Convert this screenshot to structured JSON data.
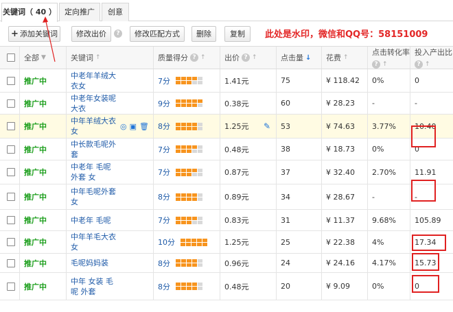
{
  "tabs": [
    {
      "label": "关键词",
      "count": "（ 40 ）",
      "active": true
    },
    {
      "label": "定向推广",
      "active": false
    },
    {
      "label": "创意",
      "active": false
    }
  ],
  "toolbar": {
    "add_keyword": "添加关键词",
    "edit_bid": "修改出价",
    "edit_match": "修改匹配方式",
    "delete": "删除",
    "copy": "复制",
    "help_glyph": "?"
  },
  "watermark": "此处是水印，微信和QQ号：58151009",
  "table": {
    "headers": {
      "all": "全部",
      "keyword": "关键词",
      "quality": "质量得分",
      "bid": "出价",
      "clicks": "点击量",
      "cost": "花费",
      "cvr": "点击转化率",
      "roi": "投入产出比"
    },
    "rows": [
      {
        "status": "推广中",
        "keyword": [
          "中老年羊绒大",
          "衣女"
        ],
        "score": "7分",
        "bars": 7,
        "bid": "1.41元",
        "clicks": "75",
        "cost": "¥ 118.42",
        "cvr": "0%",
        "roi": "0"
      },
      {
        "status": "推广中",
        "keyword": [
          "中老年女装呢",
          "大衣"
        ],
        "score": "9分",
        "bars": 9,
        "bid": "0.38元",
        "clicks": "60",
        "cost": "¥ 28.23",
        "cvr": "-",
        "roi": "-"
      },
      {
        "status": "推广中",
        "keyword": [
          "中年羊绒大衣",
          "女"
        ],
        "score": "8分",
        "bars": 8,
        "bid": "1.25元",
        "clicks": "53",
        "cost": "¥ 74.63",
        "cvr": "3.77%",
        "roi": "10.40"
      },
      {
        "status": "推广中",
        "keyword": [
          "中长款毛呢外",
          "套"
        ],
        "score": "7分",
        "bars": 7,
        "bid": "0.48元",
        "clicks": "38",
        "cost": "¥ 18.73",
        "cvr": "0%",
        "roi": "0"
      },
      {
        "status": "推广中",
        "keyword": [
          "中老年 毛呢",
          "外套 女"
        ],
        "score": "7分",
        "bars": 7,
        "bid": "0.87元",
        "clicks": "37",
        "cost": "¥ 32.40",
        "cvr": "2.70%",
        "roi": "11.91"
      },
      {
        "status": "推广中",
        "keyword": [
          "中年毛呢外套",
          "女"
        ],
        "score": "8分",
        "bars": 8,
        "bid": "0.89元",
        "clicks": "34",
        "cost": "¥ 28.67",
        "cvr": "-",
        "roi": "-"
      },
      {
        "status": "推广中",
        "keyword": [
          "中老年 毛呢"
        ],
        "score": "7分",
        "bars": 7,
        "bid": "0.83元",
        "clicks": "31",
        "cost": "¥ 11.37",
        "cvr": "9.68%",
        "roi": "105.89"
      },
      {
        "status": "推广中",
        "keyword": [
          "中年羊毛大衣",
          "女"
        ],
        "score": "10分",
        "bars": 10,
        "bid": "1.25元",
        "clicks": "25",
        "cost": "¥ 22.38",
        "cvr": "4%",
        "roi": "17.34"
      },
      {
        "status": "推广中",
        "keyword": [
          "毛呢妈妈装"
        ],
        "score": "8分",
        "bars": 8,
        "bid": "0.96元",
        "clicks": "24",
        "cost": "¥ 24.16",
        "cvr": "4.17%",
        "roi": "15.73"
      },
      {
        "status": "推广中",
        "keyword": [
          "中年 女装 毛",
          "呢 外套"
        ],
        "score": "8分",
        "bars": 8,
        "bid": "0.48元",
        "clicks": "20",
        "cost": "¥ 9.09",
        "cvr": "0%",
        "roi": "0"
      }
    ]
  },
  "highlight_color": "#e02020"
}
